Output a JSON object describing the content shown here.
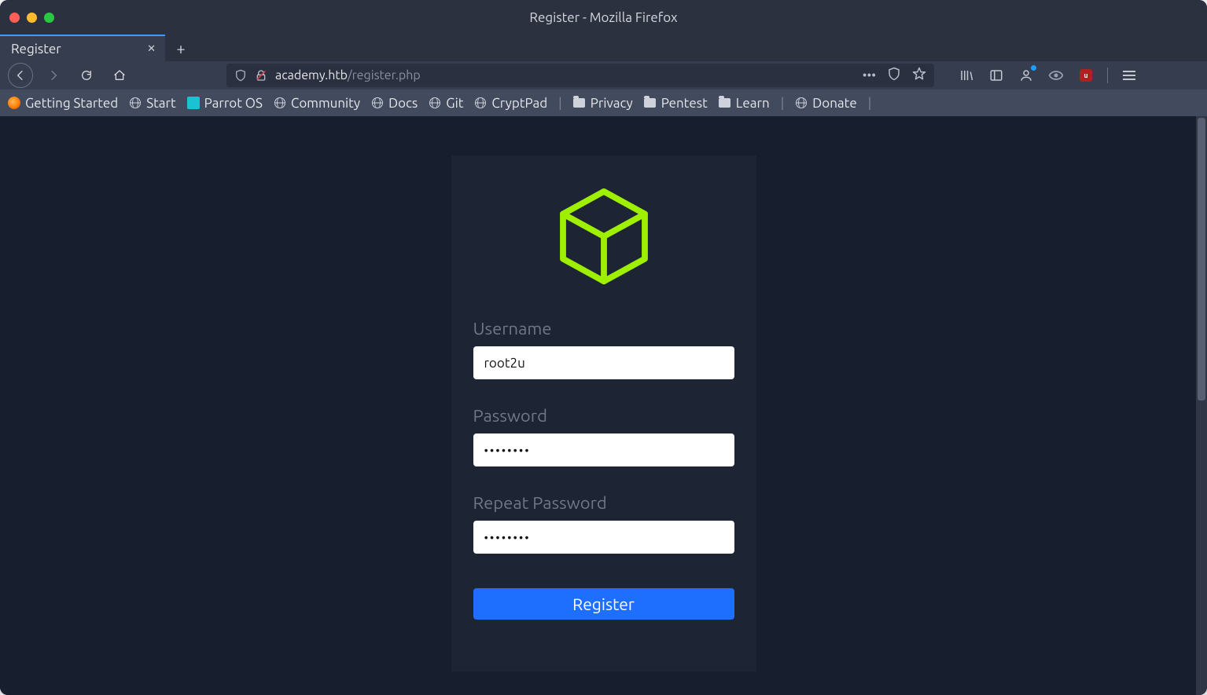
{
  "window": {
    "title": "Register - Mozilla Firefox"
  },
  "tab": {
    "title": "Register"
  },
  "url": {
    "domain": "academy.htb",
    "path": "/register.php"
  },
  "bookmarks": [
    {
      "label": "Getting Started",
      "icon": "firefox"
    },
    {
      "label": "Start",
      "icon": "globe"
    },
    {
      "label": "Parrot OS",
      "icon": "parrot"
    },
    {
      "label": "Community",
      "icon": "globe"
    },
    {
      "label": "Docs",
      "icon": "globe"
    },
    {
      "label": "Git",
      "icon": "globe"
    },
    {
      "label": "CryptPad",
      "icon": "globe",
      "sepAfter": true
    },
    {
      "label": "Privacy",
      "icon": "folder"
    },
    {
      "label": "Pentest",
      "icon": "folder"
    },
    {
      "label": "Learn",
      "icon": "folder",
      "sepAfter": true
    },
    {
      "label": "Donate",
      "icon": "globe",
      "sepAfter": true
    }
  ],
  "form": {
    "labels": {
      "username": "Username",
      "password": "Password",
      "repeat": "Repeat Password"
    },
    "values": {
      "username": "root2u",
      "password": "••••••••",
      "repeat": "••••••••"
    },
    "submit": "Register"
  }
}
